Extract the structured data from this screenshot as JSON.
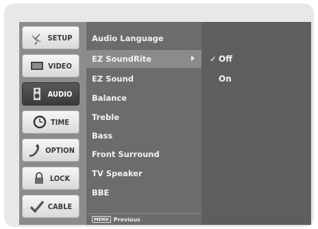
{
  "sidebar": {
    "items": [
      {
        "label": "SETUP",
        "icon": "satellite-dish-icon",
        "selected": false
      },
      {
        "label": "VIDEO",
        "icon": "tv-screen-icon",
        "selected": false
      },
      {
        "label": "AUDIO",
        "icon": "speaker-icon",
        "selected": true
      },
      {
        "label": "TIME",
        "icon": "clock-icon",
        "selected": false
      },
      {
        "label": "OPTION",
        "icon": "remote-control-icon",
        "selected": false
      },
      {
        "label": "LOCK",
        "icon": "padlock-icon",
        "selected": false
      },
      {
        "label": "CABLE",
        "icon": "check-cable-icon",
        "selected": false
      }
    ]
  },
  "menu": {
    "items": [
      {
        "label": "Audio Language",
        "selected": false
      },
      {
        "label": "EZ SoundRite",
        "selected": true
      },
      {
        "label": "EZ Sound",
        "selected": false
      },
      {
        "label": "Balance",
        "selected": false
      },
      {
        "label": "Treble",
        "selected": false
      },
      {
        "label": "Bass",
        "selected": false
      },
      {
        "label": "Front Surround",
        "selected": false
      },
      {
        "label": "TV Speaker",
        "selected": false
      },
      {
        "label": "BBE",
        "selected": false
      }
    ],
    "footer": {
      "key_label": "MENU",
      "hint": "Previous"
    }
  },
  "options": {
    "items": [
      {
        "label": "Off",
        "checked": true,
        "check_mark": "✓"
      },
      {
        "label": "On",
        "checked": false,
        "check_mark": ""
      }
    ]
  },
  "colors": {
    "panel_dark": "#5e5e5e",
    "panel_mid": "#6c6c6c",
    "highlight": "#8b8b8b",
    "selected_tab": "#3a3a3a"
  }
}
